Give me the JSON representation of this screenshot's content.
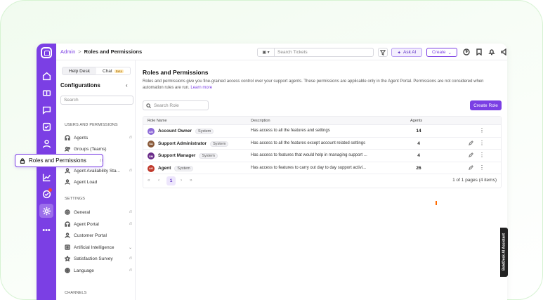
{
  "breadcrumb": {
    "parent": "Admin",
    "separator": ">",
    "current": "Roles and Permissions"
  },
  "topbar": {
    "search_placeholder": "Search Tickets",
    "ask_ai_label": "Ask AI",
    "create_label": "Create"
  },
  "config": {
    "toggle": {
      "left": "Help Desk",
      "right": "Chat",
      "right_badge": "Beta"
    },
    "title": "Configurations",
    "collapse_glyph": "‹",
    "search_placeholder": "Search",
    "sections": {
      "users": "USERS AND PERMISSIONS",
      "settings": "SETTINGS",
      "channels": "CHANNELS"
    },
    "users_items": [
      {
        "label": "Agents",
        "icon": "headset-icon"
      },
      {
        "label": "Groups (Teams)",
        "icon": "users-icon"
      },
      {
        "label": "Roles and Permissions",
        "icon": "lock-icon"
      },
      {
        "label": "Agent Availability Sta...",
        "icon": "user-status-icon"
      },
      {
        "label": "Agent Load",
        "icon": "user-load-icon"
      }
    ],
    "settings_items": [
      {
        "label": "General",
        "icon": "gear-icon"
      },
      {
        "label": "Agent Portal",
        "icon": "headset-icon"
      },
      {
        "label": "Customer Portal",
        "icon": "user-icon"
      },
      {
        "label": "Artificial Intelligence",
        "icon": "ai-icon"
      },
      {
        "label": "Satisfaction Survey",
        "icon": "star-icon"
      },
      {
        "label": "Language",
        "icon": "globe-icon"
      }
    ]
  },
  "main": {
    "title": "Roles and Permissions",
    "description": "Roles and permissions give you fine-grained access control over your support agents. These permissions are applicable only in the Agent Portal. Permissions are not considered when automation rules are run.",
    "learn_more": "Learn more",
    "search_placeholder": "Search Role",
    "create_role_label": "Create Role",
    "columns": {
      "role_name": "Role Name",
      "description": "Description",
      "agents": "Agents"
    },
    "roles": [
      {
        "initials": "AO",
        "name": "Account Owner",
        "tag": "System",
        "description": "Has access to all the features and settings",
        "agents": "14",
        "color": "#8e6bd8"
      },
      {
        "initials": "SA",
        "name": "Support Administrator",
        "tag": "System",
        "description": "Has access to all the features except account related settings",
        "agents": "4",
        "color": "#8a5a3a"
      },
      {
        "initials": "SM",
        "name": "Support Manager",
        "tag": "System",
        "description": "Has access to features that would help in managing support ...",
        "agents": "4",
        "color": "#6b2d8a"
      },
      {
        "initials": "AG",
        "name": "Agent",
        "tag": "System",
        "description": "Has access to features to carry out day to day support activi...",
        "agents": "26",
        "color": "#c0392b"
      }
    ],
    "pager": {
      "first": "«",
      "prev": "‹",
      "page": "1",
      "next": "›",
      "last": "»",
      "info": "1 of 1 pages (4 items)"
    }
  },
  "ai_tab_label": "BoldDesk AI Assistant",
  "colors": {
    "accent": "#7b3fe4",
    "rail": "#7b3fe4",
    "notification": "#f0413a",
    "orange": "#ff6b00"
  }
}
